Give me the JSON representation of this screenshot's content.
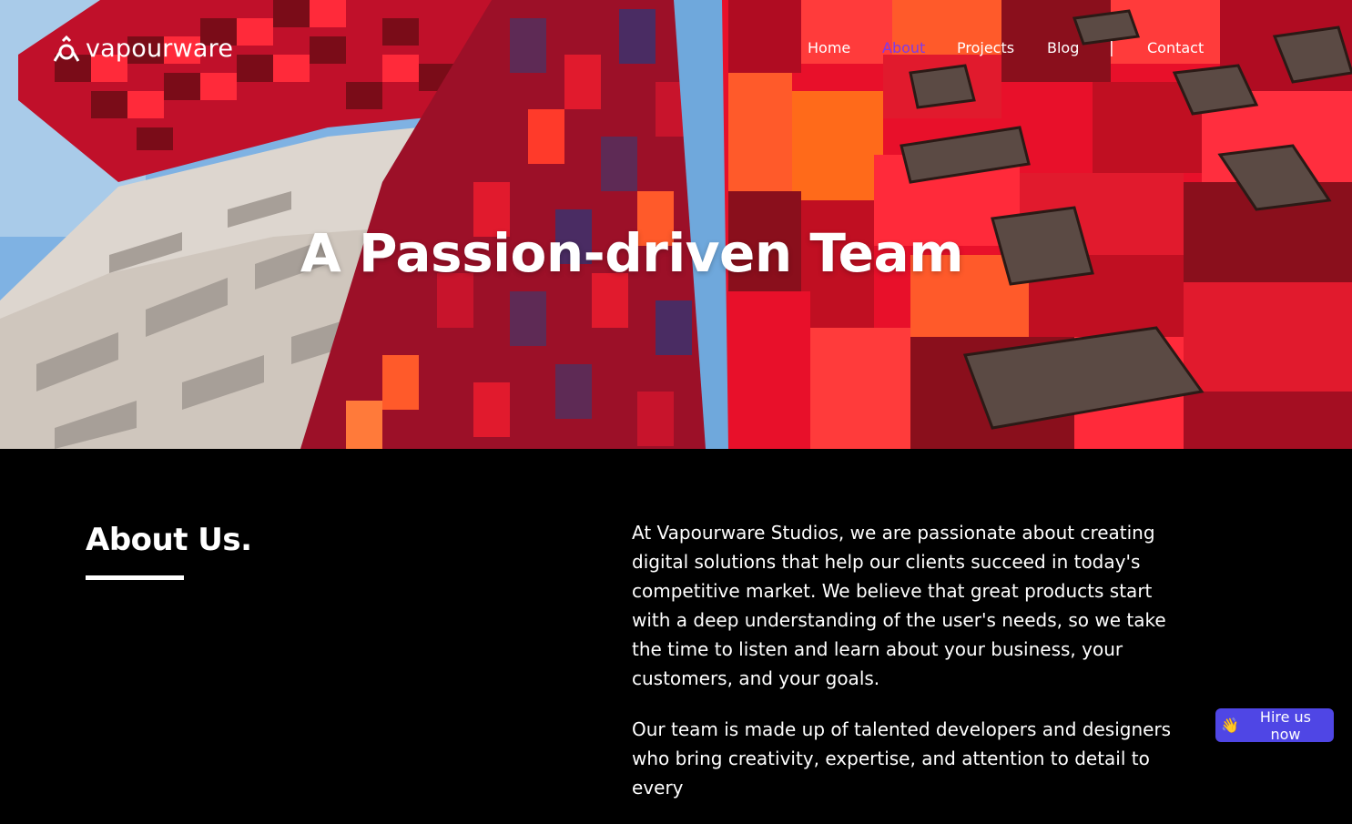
{
  "brand": {
    "name": "vapourware",
    "icon": "vapourware-logo-icon"
  },
  "nav": {
    "items": [
      {
        "label": "Home",
        "active": false
      },
      {
        "label": "About",
        "active": true
      },
      {
        "label": "Projects",
        "active": false
      },
      {
        "label": "Blog",
        "active": false
      },
      {
        "label": "Contact",
        "active": false
      }
    ],
    "separator": "|",
    "active_color": "#7c3aed"
  },
  "hero": {
    "title": "A Passion-driven Team"
  },
  "about": {
    "heading": "About Us.",
    "paragraphs": [
      "At Vapourware Studios, we are passionate about creating digital solutions that help our clients succeed in today's competitive market. We believe that great products start with a deep understanding of the user's needs, so we take the time to listen and learn about your business, your customers, and your goals.",
      "Our team is made up of talented developers and designers who bring creativity, expertise, and attention to detail to every"
    ]
  },
  "cta": {
    "emoji": "👋",
    "label": "Hire us now",
    "color": "#4f46e5"
  },
  "colors": {
    "background": "#000000",
    "sky": "#6fa8dc",
    "facade_red": "#e8102a",
    "facade_dark": "#8a0f1c",
    "facade_orange": "#ff5a2a"
  }
}
